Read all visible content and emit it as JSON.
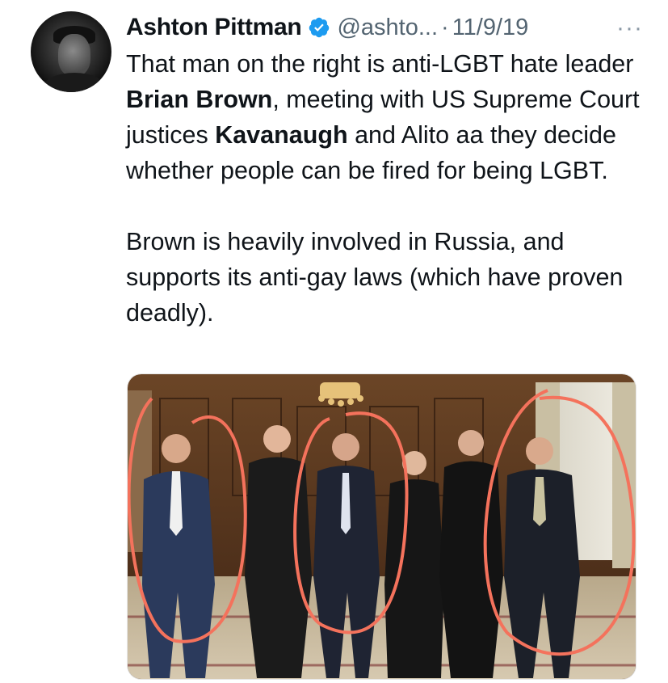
{
  "author": {
    "name": "Ashton Pittman",
    "handle": "@ashto...",
    "separator": "·",
    "date": "11/9/19",
    "verified": true,
    "avatar_icon": "user-avatar"
  },
  "more_icon": "ellipsis-icon",
  "tweet": {
    "p1_a": "That man on the right is anti-LGBT hate leader ",
    "p1_b": "Brian Brown",
    "p1_c": ", meeting with US Supreme Court justices ",
    "p1_d": "Kavanaugh",
    "p1_e": " and Alito aa they decide whether people can be fired for being LGBT.",
    "p2": "Brown is heavily involved in Russia, and supports its anti-gay laws (which have proven deadly)."
  },
  "colors": {
    "verified": "#1d9bf0",
    "muted": "#536471",
    "circle": "#f4725c"
  }
}
